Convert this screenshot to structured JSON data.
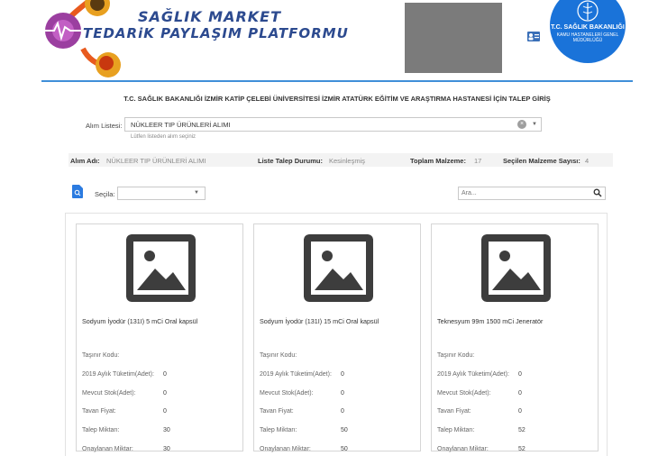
{
  "header": {
    "brand_line1": "SAĞLIK MARKET",
    "brand_line2": "TEDARiK PAYLAŞIM PLATFORMU",
    "ministry_line1": "T.C. SAĞLIK BAKANLIĞI",
    "ministry_line2": "KAMU HASTANELERİ GENEL MÜDÜRLÜĞÜ",
    "user_icon": "id-card-icon",
    "accent_color": "#3f8fd8"
  },
  "page": {
    "title": "T.C. SAĞLIK BAKANLIĞI İZMİR KATİP ÇELEBİ ÜNİVERSİTESİ İZMİR ATATÜRK EĞİTİM VE ARAŞTIRMA HASTANESİ İÇİN TALEP GİRİŞ"
  },
  "alim_listesi": {
    "label": "Alım Listesi:",
    "value": "NÜKLEER TIP ÜRÜNLERİ ALIMI",
    "hint": "Lütfen listeden alım seçiniz"
  },
  "info": {
    "alim_adi_label": "Alım Adı:",
    "alim_adi_value": "NÜKLEER TIP ÜRÜNLERİ ALIMI",
    "durum_label": "Liste Talep Durumu:",
    "durum_value": "Kesinleşmiş",
    "toplam_label": "Toplam Malzeme:",
    "toplam_value": "17",
    "secilen_label": "Seçilen Malzeme Sayısı:",
    "secilen_value": "4"
  },
  "toolbar": {
    "secim_label": "Seçila:",
    "secim_value": "",
    "search_placeholder": "Ara..."
  },
  "card_fields": {
    "tasinir": "Taşınır Kodu:",
    "tuketim": "2019 Aylık Tüketim(Adet):",
    "stok": "Mevcut Stok(Adet):",
    "tavan": "Tavan Fiyat:",
    "talep": "Talep Miktarı:",
    "onaylanan": "Onaylanan Miktar:"
  },
  "cards": [
    {
      "title": "Sodyum İyodür (131I) 5 mCi Oral kapsül",
      "tasinir": "",
      "tuketim": "0",
      "stok": "0",
      "tavan": "0",
      "talep": "30",
      "onaylanan": "30"
    },
    {
      "title": "Sodyum İyodür (131I) 15 mCi Oral kapsül",
      "tasinir": "",
      "tuketim": "0",
      "stok": "0",
      "tavan": "0",
      "talep": "50",
      "onaylanan": "50"
    },
    {
      "title": "Teknesyum 99m 1500 mCi Jeneratör",
      "tasinir": "",
      "tuketim": "0",
      "stok": "0",
      "tavan": "0",
      "talep": "52",
      "onaylanan": "52"
    }
  ]
}
